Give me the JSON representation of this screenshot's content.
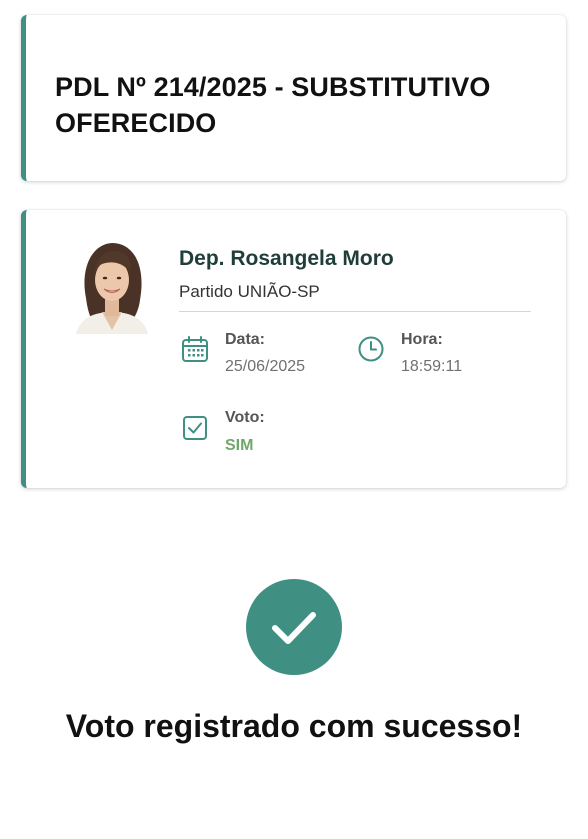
{
  "proposal": {
    "title": "PDL Nº 214/2025 - SUBSTITUTIVO OFERECIDO"
  },
  "deputy": {
    "name": "Dep. Rosangela Moro",
    "party": "Partido UNIÃO-SP",
    "avatar_icon": "person-photo"
  },
  "vote_info": {
    "date_label": "Data:",
    "date_value": "25/06/2025",
    "date_icon": "calendar-icon",
    "time_label": "Hora:",
    "time_value": "18:59:11",
    "time_icon": "clock-icon",
    "vote_label": "Voto:",
    "vote_value": "SIM",
    "vote_icon": "checkbox-icon"
  },
  "confirmation": {
    "icon": "checkmark-icon",
    "message": "Voto registrado com sucesso!"
  },
  "colors": {
    "accent": "#3f8f82",
    "vote_yes": "#6fa86a",
    "name": "#1f3e3a"
  }
}
